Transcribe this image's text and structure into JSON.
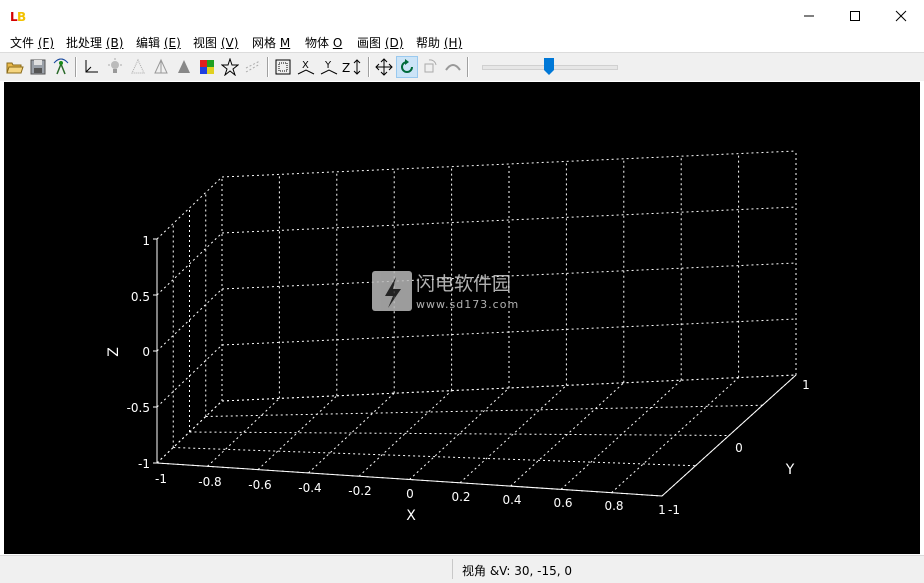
{
  "app": {
    "icon_glyph": "LB",
    "accent": "#f2c200"
  },
  "window_controls": {
    "minimize_icon": "minimize-icon",
    "maximize_icon": "maximize-icon",
    "close_icon": "close-icon"
  },
  "menu": [
    {
      "label": "文件",
      "key": "(F)"
    },
    {
      "label": "批处理",
      "key": "(B)"
    },
    {
      "label": "编辑",
      "key": "(E)"
    },
    {
      "label": "视图",
      "key": "(V)"
    },
    {
      "label": "网格",
      "key": "M"
    },
    {
      "label": "物体",
      "key": "O"
    },
    {
      "label": "画图",
      "key": "(D)"
    },
    {
      "label": "帮助",
      "key": "(H)"
    }
  ],
  "toolbar": {
    "buttons": [
      "open-folder-icon",
      "save-icon",
      "antenna-icon",
      "axes-icon",
      "light-icon",
      "wire-cone-icon",
      "shaded-cone-icon",
      "solid-cone-icon",
      "color-cube-icon",
      "star-icon",
      "scatter-icon",
      "bounding-box-icon",
      "axes-x-icon",
      "axes-y-icon",
      "zaxis-scale-icon",
      "move-icon",
      "rotate-icon",
      "rotate-object-icon",
      "arc-icon"
    ],
    "active": "rotate-icon",
    "slider_value": 0.5
  },
  "plot": {
    "x_axis_label": "X",
    "y_axis_label": "Y",
    "z_axis_label": "Z",
    "x_ticks": [
      "-1",
      "-0.8",
      "-0.6",
      "-0.4",
      "-0.2",
      "0",
      "0.2",
      "0.4",
      "0.6",
      "0.8",
      "1"
    ],
    "y_ticks": [
      "-1",
      "0",
      "1"
    ],
    "z_ticks": [
      "1",
      "0.5",
      "0",
      "-0.5",
      "-1"
    ],
    "grid": true,
    "grid_color": "#ffffff",
    "background": "#000000"
  },
  "watermark": {
    "title": "闪电软件园",
    "url": "www.sd173.com"
  },
  "status": {
    "text": "视角 &V: 30, -15, 0"
  }
}
